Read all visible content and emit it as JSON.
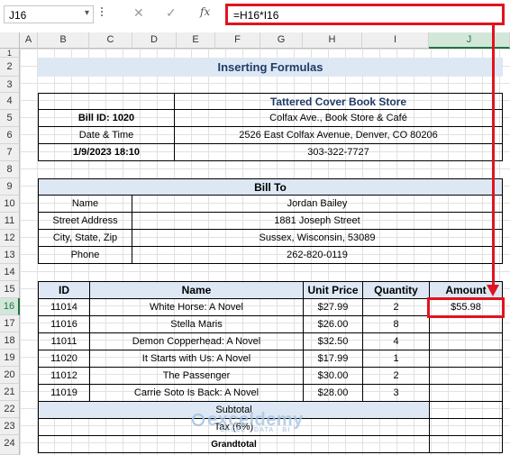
{
  "formula_bar": {
    "name_box": "J16",
    "cancel_icon": "✕",
    "enter_icon": "✓",
    "fx_label": "fx",
    "formula": "=H16*I16"
  },
  "columns": [
    "A",
    "B",
    "C",
    "D",
    "E",
    "F",
    "G",
    "H",
    "I",
    "J"
  ],
  "rows": [
    "1",
    "2",
    "3",
    "4",
    "5",
    "6",
    "7",
    "8",
    "9",
    "10",
    "11",
    "12",
    "13",
    "14",
    "15",
    "16",
    "17",
    "18",
    "19",
    "20",
    "21",
    "22",
    "23",
    "24"
  ],
  "selected": {
    "column": "J",
    "row": "16"
  },
  "sheet": {
    "title": "Inserting Formulas",
    "store_name": "Tattered Cover Book Store",
    "bill_id": "Bill ID: 1020",
    "store_address1": "Colfax Ave., Book Store & Café",
    "date_time_label": "Date & Time",
    "store_address2": "2526 East Colfax Avenue, Denver, CO 80206",
    "date_time_value": "1/9/2023 18:10",
    "store_phone": "303-322-7727",
    "bill_to_header": "Bill To",
    "name_label": "Name",
    "name_value": "Jordan Bailey",
    "street_label": "Street Address",
    "street_value": "1881 Joseph Street",
    "city_label": "City, State, Zip",
    "city_value": "Sussex, Wisconsin, 53089",
    "phone_label": "Phone",
    "phone_value": "262-820-0119",
    "table_headers": [
      "ID",
      "Name",
      "Unit Price",
      "Quantity",
      "Amount"
    ],
    "items": [
      {
        "id": "11014",
        "name": "White Horse: A Novel",
        "price": "$27.99",
        "qty": "2",
        "amount": "$55.98"
      },
      {
        "id": "11016",
        "name": "Stella Maris",
        "price": "$26.00",
        "qty": "8",
        "amount": ""
      },
      {
        "id": "11011",
        "name": "Demon Copperhead: A Novel",
        "price": "$32.50",
        "qty": "4",
        "amount": ""
      },
      {
        "id": "11020",
        "name": "It Starts with Us: A Novel",
        "price": "$17.99",
        "qty": "1",
        "amount": ""
      },
      {
        "id": "11012",
        "name": "The Passenger",
        "price": "$30.00",
        "qty": "2",
        "amount": ""
      },
      {
        "id": "11019",
        "name": "Carrie Soto Is Back: A Novel",
        "price": "$28.00",
        "qty": "3",
        "amount": ""
      }
    ],
    "subtotal_label": "Subtotal",
    "tax_label": "Tax (6%)",
    "grandtotal_label": "Grandtotal"
  },
  "watermark": {
    "text": "exceldemy",
    "tagline": "EXCEL · DATA · BI"
  },
  "colors": {
    "accent_red": "#e0141e",
    "header_fill": "#dde8f4",
    "excel_green": "#217346"
  }
}
